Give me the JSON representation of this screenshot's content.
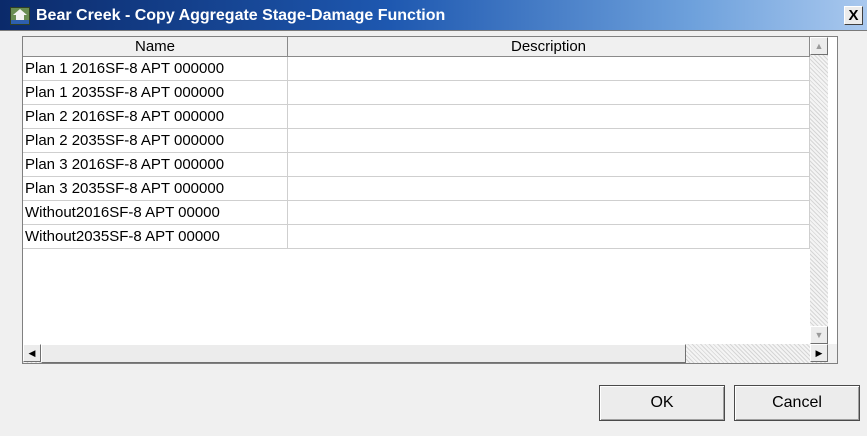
{
  "window": {
    "title": "Bear Creek - Copy Aggregate Stage-Damage Function",
    "close_label": "X"
  },
  "table": {
    "columns": [
      "Name",
      "Description"
    ],
    "rows": [
      {
        "name": "Plan 1 2016SF-8   APT  000000",
        "description": ""
      },
      {
        "name": "Plan 1 2035SF-8   APT  000000",
        "description": ""
      },
      {
        "name": "Plan 2 2016SF-8   APT  000000",
        "description": ""
      },
      {
        "name": "Plan 2 2035SF-8   APT  000000",
        "description": ""
      },
      {
        "name": "Plan 3 2016SF-8   APT  000000",
        "description": ""
      },
      {
        "name": "Plan 3 2035SF-8   APT  000000",
        "description": ""
      },
      {
        "name": "Without2016SF-8   APT  00000",
        "description": ""
      },
      {
        "name": "Without2035SF-8   APT  00000",
        "description": ""
      }
    ]
  },
  "buttons": {
    "ok": "OK",
    "cancel": "Cancel"
  },
  "icons": {
    "app": "house-icon",
    "close": "close-icon",
    "scroll_up": "arrow-up-icon",
    "scroll_down": "arrow-down-icon",
    "scroll_left": "arrow-left-icon",
    "scroll_right": "arrow-right-icon"
  }
}
